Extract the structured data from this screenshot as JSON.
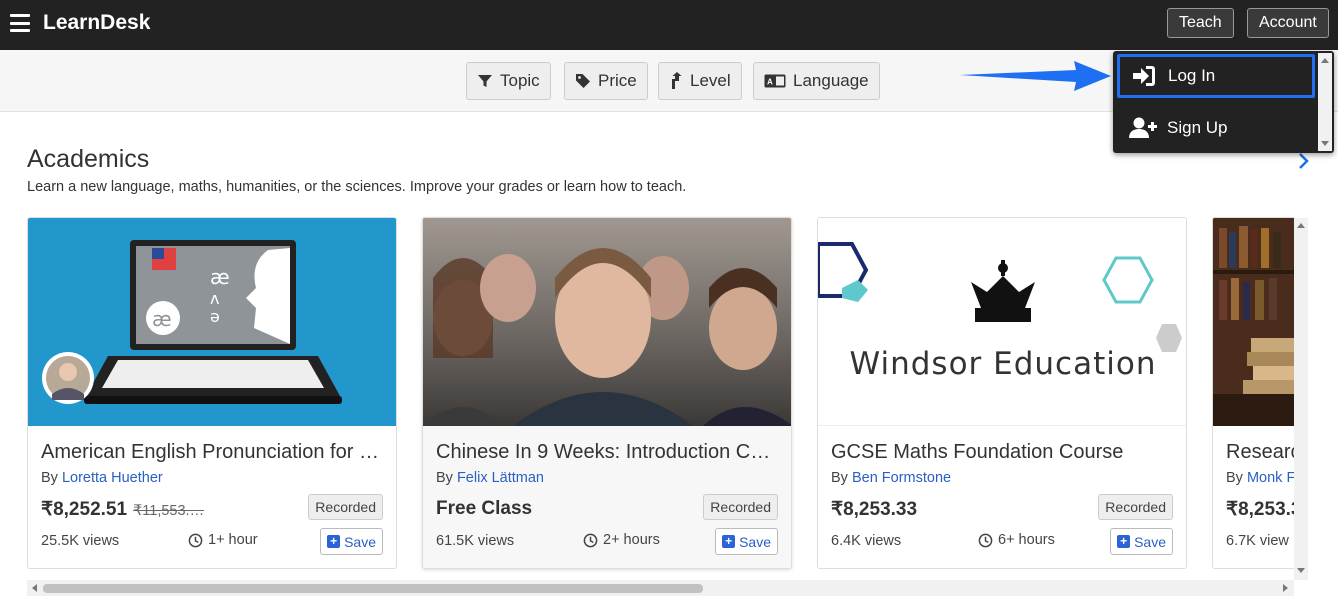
{
  "app": {
    "brand": "LearnDesk"
  },
  "topbar": {
    "teach_label": "Teach",
    "account_label": "Account"
  },
  "filters": [
    {
      "label": "Topic",
      "icon": "funnel-icon"
    },
    {
      "label": "Price",
      "icon": "tag-icon"
    },
    {
      "label": "Level",
      "icon": "level-arrow-icon"
    },
    {
      "label": "Language",
      "icon": "language-card-icon"
    }
  ],
  "account_menu": {
    "items": [
      {
        "label": "Log In",
        "icon": "log-in-icon",
        "focused": true
      },
      {
        "label": "Sign Up",
        "icon": "user-plus-icon",
        "focused": false
      }
    ]
  },
  "section": {
    "title": "Academics",
    "subtitle": "Learn a new language, maths, humanities, or the sciences. Improve your grades or learn how to teach."
  },
  "cards": [
    {
      "title": "American English Pronunciation for …",
      "by": "By",
      "author": "Loretta Huether",
      "price": "₹8,252.51",
      "old_price": "₹11,553.…",
      "badge": "Recorded",
      "views": "25.5K views",
      "duration": "1+ hour",
      "save": "Save"
    },
    {
      "title": "Chinese In 9 Weeks: Introduction Co…",
      "by": "By",
      "author": "Felix Lättman",
      "price": "Free Class",
      "old_price": "",
      "badge": "Recorded",
      "views": "61.5K views",
      "duration": "2+ hours",
      "save": "Save"
    },
    {
      "title": "GCSE Maths Foundation Course",
      "by": "By",
      "author": "Ben Formstone",
      "price": "₹8,253.33",
      "old_price": "",
      "badge": "Recorded",
      "views": "6.4K views",
      "duration": "6+ hours",
      "save": "Save",
      "thumb_text": "Windsor Education"
    },
    {
      "title": "Researc",
      "by": "By",
      "author": "Monk F",
      "price": "₹8,253.3",
      "old_price": "",
      "badge": "",
      "views": "6.7K view",
      "duration": "",
      "save": ""
    }
  ],
  "colors": {
    "topbar": "#222222",
    "link": "#2a5fc4",
    "focus_ring": "#1e6ff2",
    "thumb_blue": "#2197cc"
  }
}
